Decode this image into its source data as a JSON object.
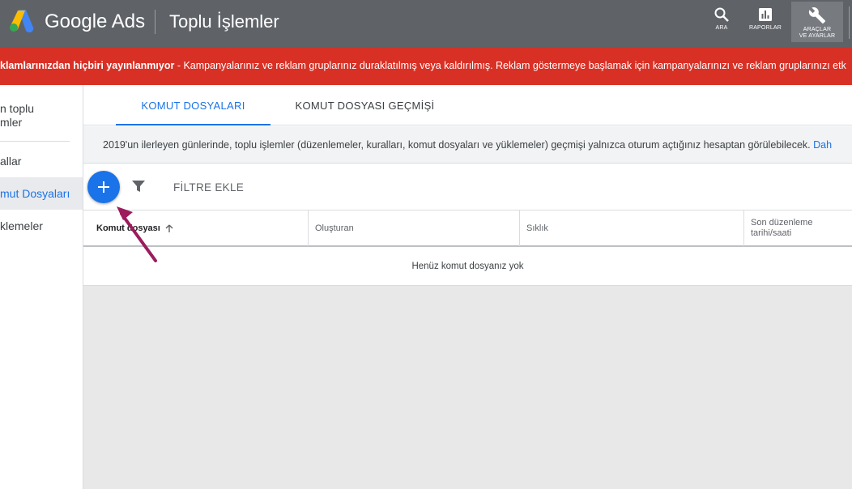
{
  "header": {
    "brand": "Google Ads",
    "page_title": "Toplu İşlemler",
    "actions": [
      {
        "label": "ARA",
        "icon": "search-icon"
      },
      {
        "label": "RAPORLAR",
        "icon": "reports-icon"
      },
      {
        "label_line1": "ARAÇLAR",
        "label_line2": "VE AYARLAR",
        "icon": "wrench-icon"
      }
    ]
  },
  "alert": {
    "bold": "klamlarınızdan hiçbiri yayınlanmıyor",
    "text": " - Kampanyalarınız ve reklam gruplarınız duraklatılmış veya kaldırılmış. Reklam göstermeye başlamak için kampanyalarınızı ve reklam gruplarınızı etk"
  },
  "sidebar": {
    "items": [
      {
        "line1": "n toplu",
        "line2": "mler"
      },
      {
        "label": "allar"
      },
      {
        "label": "mut Dosyaları",
        "active": true
      },
      {
        "label": "klemeler"
      }
    ]
  },
  "tabs": [
    {
      "label": "KOMUT DOSYALARI",
      "active": true
    },
    {
      "label": "KOMUT DOSYASI GEÇMİŞİ"
    }
  ],
  "notice": {
    "text": "2019'un ilerleyen günlerinde, toplu işlemler (düzenlemeler, kuralları, komut dosyaları ve yüklemeler) geçmişi yalnızca oturum açtığınız hesaptan görülebilecek. ",
    "link": "Dah"
  },
  "toolbar": {
    "add_icon": "plus-icon",
    "filter_icon": "filter-icon",
    "filter_label": "FİLTRE EKLE"
  },
  "table": {
    "columns": [
      "Komut dosyası",
      "Oluşturan",
      "Sıklık",
      "Son düzenleme tarihi/saati"
    ],
    "col4_line1": "Son düzenleme",
    "col4_line2": "tarihi/saati",
    "empty_text": "Henüz komut dosyanız yok"
  },
  "colors": {
    "topbar": "#5f6368",
    "alert": "#d93025",
    "accent": "#1a73e8",
    "annotation_arrow": "#9c1c5c"
  }
}
